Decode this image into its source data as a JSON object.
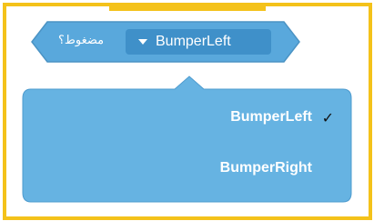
{
  "block": {
    "label": "مضغوط؟",
    "selected_value": "BumperLeft"
  },
  "menu": {
    "items": [
      {
        "label": "BumperLeft",
        "checked": true
      },
      {
        "label": "BumperRight",
        "checked": false
      }
    ],
    "check_glyph": "✓"
  },
  "colors": {
    "frame": "#f4c21a",
    "block": "#59a8dc",
    "field": "#3f90c9",
    "menu": "#66b3e2"
  },
  "icons": {
    "dropdown": "dropdown-triangle-icon",
    "check": "check-icon"
  }
}
